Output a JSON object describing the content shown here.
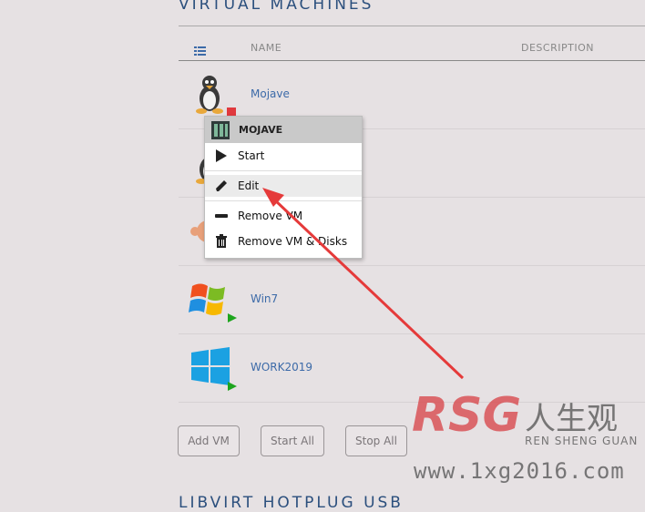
{
  "sections": {
    "vm_title": "VIRTUAL MACHINES",
    "hotplug_title": "LIBVIRT HOTPLUG USB"
  },
  "table": {
    "col_name": "NAME",
    "col_description": "DESCRIPTION",
    "header_icon": "list-icon"
  },
  "vms": [
    {
      "name": "Mojave",
      "icon": "linux-tux-icon",
      "status": "stopped"
    },
    {
      "name": "",
      "icon": "linux-tux-icon",
      "status": "stopped"
    },
    {
      "name": "",
      "icon": "ubuntu-icon",
      "status": "stopped"
    },
    {
      "name": "Win7",
      "icon": "windows7-icon",
      "status": "running"
    },
    {
      "name": "WORK2019",
      "icon": "windows10-icon",
      "status": "running"
    }
  ],
  "buttons": {
    "add_vm": "Add VM",
    "start_all": "Start All",
    "stop_all": "Stop All"
  },
  "context_menu": {
    "title": "MOJAVE",
    "items": [
      {
        "label": "Start",
        "icon": "play-icon"
      },
      {
        "label": "Edit",
        "icon": "pencil-icon"
      },
      {
        "label": "Remove VM",
        "icon": "minus-icon"
      },
      {
        "label": "Remove VM & Disks",
        "icon": "trash-icon"
      }
    ]
  },
  "watermark": {
    "brand": "RSG",
    "cn": "人生观",
    "sub": "REN SHENG GUAN",
    "url": "www.1xg2016.com"
  },
  "colors": {
    "accent": "#2b4f7d",
    "link": "#3c6aa8",
    "running": "#1ea51e",
    "stopped": "#e0393e",
    "arrow": "#e53a3a"
  }
}
